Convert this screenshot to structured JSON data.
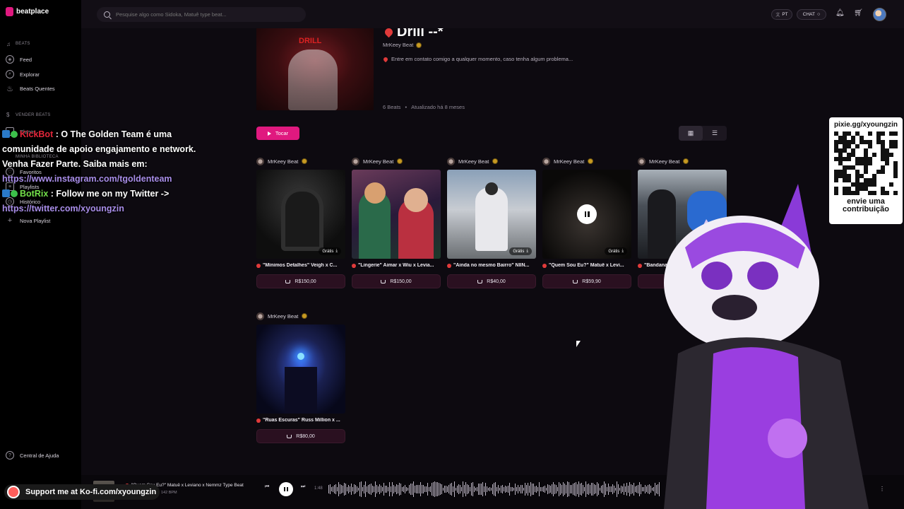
{
  "app": {
    "logo": "beatplace"
  },
  "sidebar": {
    "section_beats": "BEATS",
    "items": [
      {
        "label": "Feed",
        "icon": "compass-icon"
      },
      {
        "label": "Explorar",
        "icon": "search-icon"
      },
      {
        "label": "Beats Quentes",
        "icon": "flame-icon"
      }
    ],
    "section_vender": "VENDER BEATS",
    "section_biblioteca": "MINHA BIBLIOTECA",
    "library_items": [
      {
        "label": "Favoritos"
      },
      {
        "label": "Playlists"
      },
      {
        "label": "Histórico"
      },
      {
        "label": "Nova Playlist"
      }
    ],
    "plans_label": "Planos",
    "help": "Central de Ajuda"
  },
  "search": {
    "placeholder": "Pesquise algo como Sidoka, Matuê type beat..."
  },
  "topbar": {
    "lang": "PT",
    "chat": "CHAT"
  },
  "collection": {
    "title": "Drill --*",
    "author": "MrKeey Beat",
    "description": "Entre em contato comigo a qualquer momento, caso tenha algum problema...",
    "beats_count": "6 Beats",
    "updated": "Atualizado há 8 meses",
    "play_label": "Tocar",
    "cover_text": "DRILL"
  },
  "cards": [
    {
      "author": "MrKeey Beat",
      "title": "\"Mínimos Detalhes\" Veigh x C...",
      "price": "R$150,00",
      "badge": "Grátis"
    },
    {
      "author": "MrKeey Beat",
      "title": "\"Lingerie\" Aimar x Wiu x Levia...",
      "price": "R$150,00",
      "badge": ""
    },
    {
      "author": "MrKeey Beat",
      "title": "\"Ainda no mesmo Bairro\" NIIN...",
      "price": "R$40,00",
      "badge": "Grátis"
    },
    {
      "author": "MrKeey Beat",
      "title": "\"Quem Sou Eu?\" Matuê x Levi...",
      "price": "R$59,90",
      "badge": "Grátis"
    },
    {
      "author": "MrKeey Beat",
      "title": "\"Bandana\" UK",
      "price": "R$",
      "badge": ""
    },
    {
      "author": "MrKeey Beat",
      "title": "\"Ruas Escuras\" Russ Million x ...",
      "price": "R$80,00",
      "badge": ""
    }
  ],
  "player": {
    "title": "\"Quem Sou Eu?\" Matuê x Leviano x Nemmz Type Beat",
    "bpm": "142 BPM",
    "time": "1:48",
    "progress": 0.02
  },
  "overlay": {
    "chat": [
      {
        "name": "KickBot",
        "text": ": O The Golden Team é uma comunidade de apoio engajamento e network. Venha Fazer Parte. Saiba mais em:",
        "link": "https://www.instagram.com/tgoldenteam"
      },
      {
        "name": "BotRix",
        "text": ": Follow me on my Twitter ->",
        "link": "https://twitter.com/xyoungzin"
      }
    ],
    "qr_url": "pixie.gg/xyoungzin",
    "qr_line1": "envie uma",
    "qr_line2": "contribuição",
    "kofi": "Support me at Ko-fi.com/xyoungzin"
  },
  "colors": {
    "accent": "#e0197f",
    "bg": "#0d0a10",
    "sidebar": "#000000"
  }
}
